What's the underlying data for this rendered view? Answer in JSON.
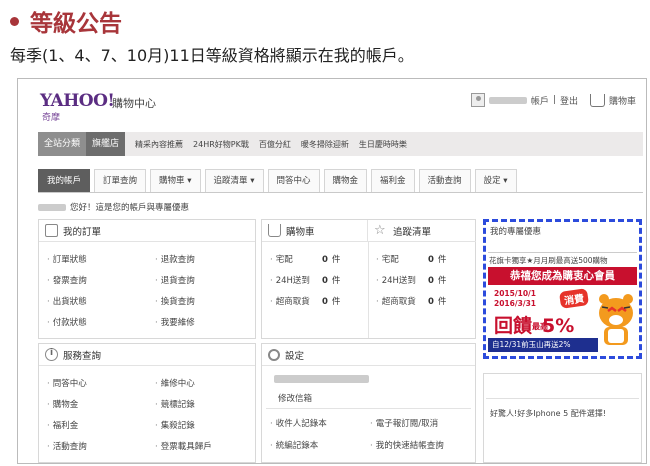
{
  "slide": {
    "title": "等級公告",
    "subtitle": "每季(1、4、7、10月)11日等級資格將顯示在我的帳戶。"
  },
  "site": {
    "logo": "YAHOO!",
    "logo_sub": "奇摩",
    "logo_name": "購物中心",
    "account_suffix": "帳戶",
    "logout": "登出",
    "cart": "購物車"
  },
  "category_bar": {
    "all_label": "全站分類",
    "flagship_label": "旗艦店",
    "links": [
      "精采內容推薦",
      "24HR好物PK戰",
      "百億分紅",
      "暖冬掃除迎新",
      "生日慶時時樂"
    ]
  },
  "tabs": [
    "我的帳戶",
    "訂單查詢",
    "購物車 ▾",
    "追蹤清單 ▾",
    "問答中心",
    "購物金",
    "福利金",
    "活動查詢",
    "設定 ▾"
  ],
  "greeting": "您好！這是您的帳戶與專屬優惠",
  "orders": {
    "title": "我的訂單",
    "col1": [
      "訂單狀態",
      "發票查詢",
      "出貨狀態",
      "付款狀態"
    ],
    "col2": [
      "退款查詢",
      "退貨查詢",
      "換貨查詢",
      "我要維修"
    ]
  },
  "cart_panel": {
    "title": "購物車",
    "items": [
      "宅配",
      "24H送到",
      "超商取貨"
    ],
    "counts": [
      "0",
      "0",
      "0"
    ],
    "unit": "件"
  },
  "tracking": {
    "title": "追蹤清單",
    "items": [
      "宅配",
      "24H送到",
      "超商取貨"
    ],
    "counts": [
      "0",
      "0",
      "0"
    ],
    "unit": "件"
  },
  "service": {
    "title": "服務查詢",
    "col1": [
      "問答中心",
      "購物金",
      "福利金",
      "活動查詢"
    ],
    "col2": [
      "維修中心",
      "競標記錄",
      "集殺記錄",
      "登票載具歸戶"
    ]
  },
  "settings": {
    "title": "設定",
    "edit_mail": "修改信箱",
    "col1": [
      "收件人記錄本",
      "統編記錄本"
    ],
    "col2": [
      "電子報訂閱/取消",
      "我的快速結帳查詢"
    ]
  },
  "promo": {
    "title": "我的專屬優惠",
    "note": "花旗卡獨享★月月刷最高送500購物",
    "banner_top": "恭禧您成為購衷心會員",
    "date_start": "2015/10/1",
    "date_end": "2016/3/31",
    "tag": "消費",
    "big": "回饋",
    "big_mid": "最高",
    "big_pct": "5%",
    "footer": "自12/31前玉山再送2%"
  },
  "promo2": {
    "text": "好驚人!好多Iphone 5 配件選擇!"
  },
  "colors": {
    "title_red": "#a8353a",
    "highlight_blue": "#2c4bdc",
    "banner_red": "#c8102e"
  }
}
